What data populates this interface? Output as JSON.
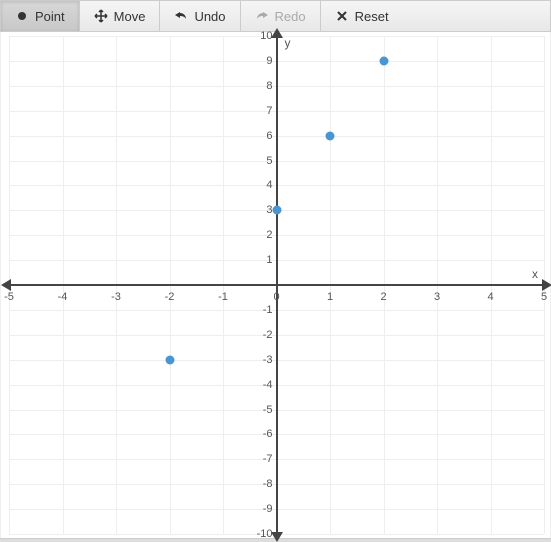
{
  "toolbar": {
    "point": "Point",
    "move": "Move",
    "undo": "Undo",
    "redo": "Redo",
    "reset": "Reset"
  },
  "chart_data": {
    "type": "scatter",
    "title": "",
    "xlabel": "x",
    "ylabel": "y",
    "xlim": [
      -5,
      5
    ],
    "ylim": [
      -10,
      10
    ],
    "x_ticks": [
      -5,
      -4,
      -3,
      -2,
      -1,
      0,
      1,
      2,
      3,
      4,
      5
    ],
    "y_ticks": [
      -10,
      -9,
      -8,
      -7,
      -6,
      -5,
      -4,
      -3,
      -2,
      -1,
      1,
      2,
      3,
      4,
      5,
      6,
      7,
      8,
      9,
      10
    ],
    "series": [
      {
        "name": "points",
        "data": [
          {
            "x": -2,
            "y": -3
          },
          {
            "x": 0,
            "y": 3
          },
          {
            "x": 1,
            "y": 6
          },
          {
            "x": 2,
            "y": 9
          }
        ]
      }
    ]
  },
  "colors": {
    "point": "#4a96d2",
    "axis": "#444",
    "grid": "#eee"
  }
}
